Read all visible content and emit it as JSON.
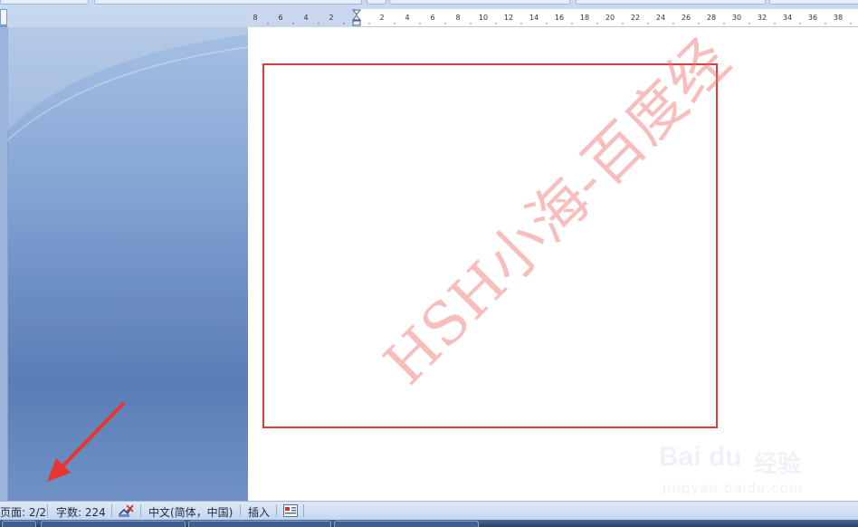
{
  "ruler": {
    "left_ticks": [
      "8",
      "6",
      "4",
      "2"
    ],
    "right_ticks": [
      "2",
      "4",
      "6",
      "8",
      "10",
      "12",
      "14",
      "16",
      "18",
      "20",
      "22",
      "24",
      "26",
      "28",
      "30",
      "32",
      "34",
      "36",
      "38"
    ]
  },
  "document": {
    "watermark": "HSH小海-百度经"
  },
  "baidu": {
    "brand_text": "Bai du",
    "cn_text": "经验",
    "url": "jingyan.baidu.com"
  },
  "status_bar": {
    "page": "页面: 2/2",
    "word_count": "字数: 224",
    "language": "中文(简体，中国)",
    "mode": "插入"
  },
  "colors": {
    "annotation_red": "#e03a3a",
    "arrow_red": "#e8352f"
  },
  "icons": [
    "spelling-check-icon",
    "macro-record-icon",
    "arrow-annotation"
  ]
}
